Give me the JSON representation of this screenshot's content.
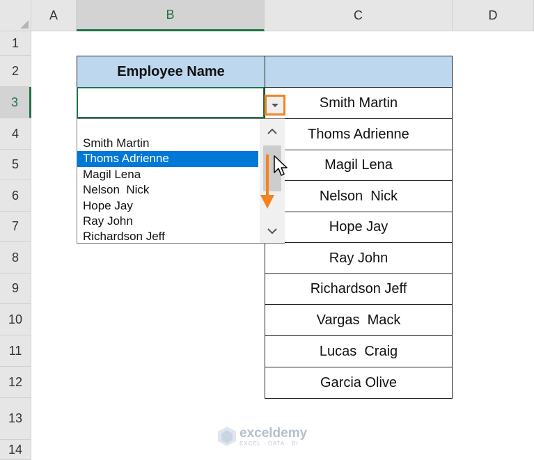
{
  "columns": [
    "A",
    "B",
    "C",
    "D"
  ],
  "rows": [
    "1",
    "2",
    "3",
    "4",
    "5",
    "6",
    "7",
    "8",
    "9",
    "10",
    "11",
    "12",
    "13",
    "14"
  ],
  "table": {
    "header_b": "Employee Name",
    "header_c": "",
    "names": [
      "Smith Martin",
      "Thoms Adrienne",
      "Magil Lena",
      "Nelson  Nick",
      "Hope Jay",
      "Ray John",
      "Richardson Jeff",
      "Vargas  Mack",
      "Lucas  Craig",
      "Garcia Olive"
    ]
  },
  "active_cell": {
    "ref": "B3",
    "value": ""
  },
  "dropdown": {
    "items": [
      "Smith Martin",
      "Thoms Adrienne",
      "Magil Lena",
      "Nelson  Nick",
      "Hope Jay",
      "Ray John",
      "Richardson Jeff"
    ],
    "selected_index": 1
  },
  "watermark": {
    "name": "exceldemy",
    "tagline": "EXCEL · DATA · BI"
  },
  "colors": {
    "header_fill": "#bdd7ee",
    "excel_green": "#217346",
    "selection_blue": "#0078d7",
    "highlight_orange": "#f58220"
  },
  "icons": [
    "dropdown-arrow-icon",
    "scroll-up-icon",
    "scroll-down-icon",
    "down-arrow-icon",
    "mouse-cursor-icon",
    "exceldemy-logo-icon"
  ]
}
